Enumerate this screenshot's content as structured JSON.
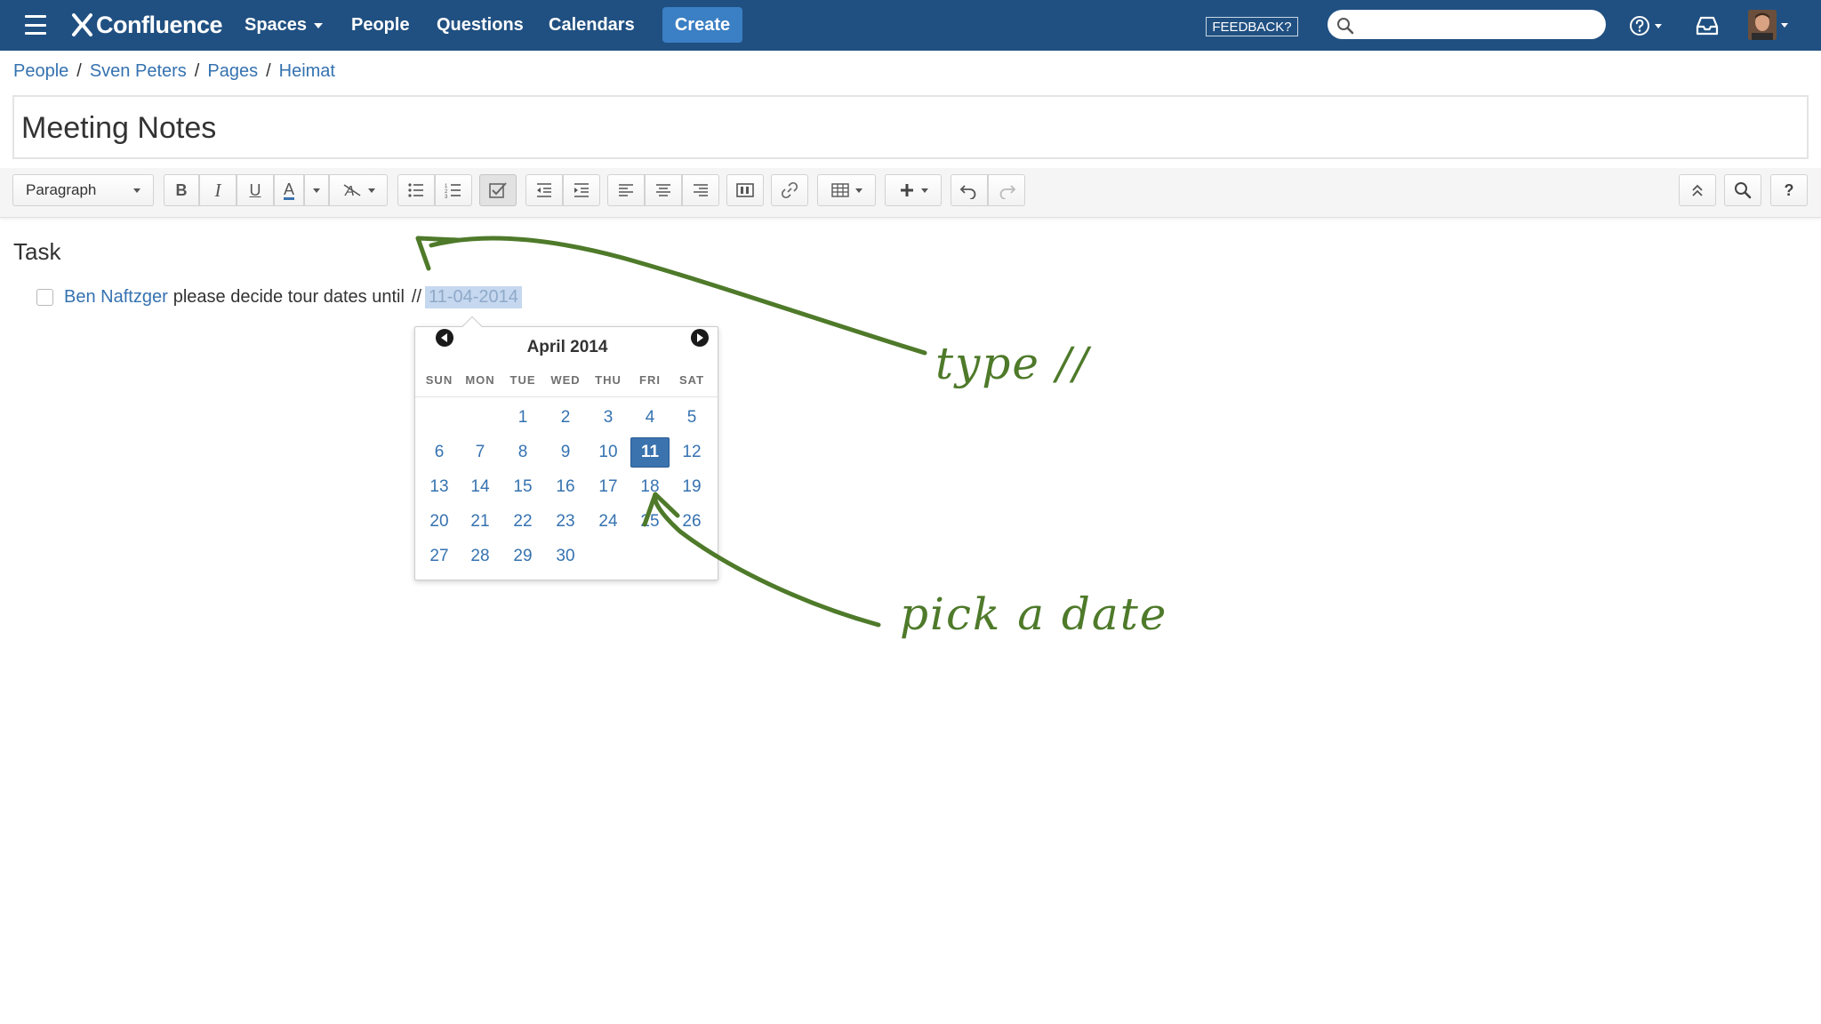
{
  "nav": {
    "brand": "Confluence",
    "items": [
      {
        "label": "Spaces",
        "dropdown": true
      },
      {
        "label": "People",
        "dropdown": false
      },
      {
        "label": "Questions",
        "dropdown": false
      },
      {
        "label": "Calendars",
        "dropdown": false
      }
    ],
    "create_label": "Create",
    "feedback_label": "FEEDBACK?",
    "search_placeholder": "",
    "background": "#205081",
    "create_color": "#3b7fc4"
  },
  "breadcrumb": [
    "People",
    "Sven Peters",
    "Pages",
    "Heimat"
  ],
  "page_title": "Meeting Notes",
  "toolbar": {
    "paragraph_label": "Paragraph",
    "bold": "B",
    "italic": "I",
    "underline": "U",
    "text_color": "A"
  },
  "content": {
    "heading": "Task",
    "task": {
      "mention": "Ben Naftzger",
      "text": "please decide tour dates until",
      "trigger": "//",
      "date": "11-04-2014"
    }
  },
  "datepicker": {
    "month_label": "April 2014",
    "weekdays": [
      "SUN",
      "MON",
      "TUE",
      "WED",
      "THU",
      "FRI",
      "SAT"
    ],
    "first_weekday_index": 2,
    "days_in_month": 30,
    "selected_day": 11,
    "selected_color": "#3b73af"
  },
  "annotations": {
    "type_hint": "type //",
    "pick_hint": "pick a date",
    "color": "#4e7a2a"
  }
}
